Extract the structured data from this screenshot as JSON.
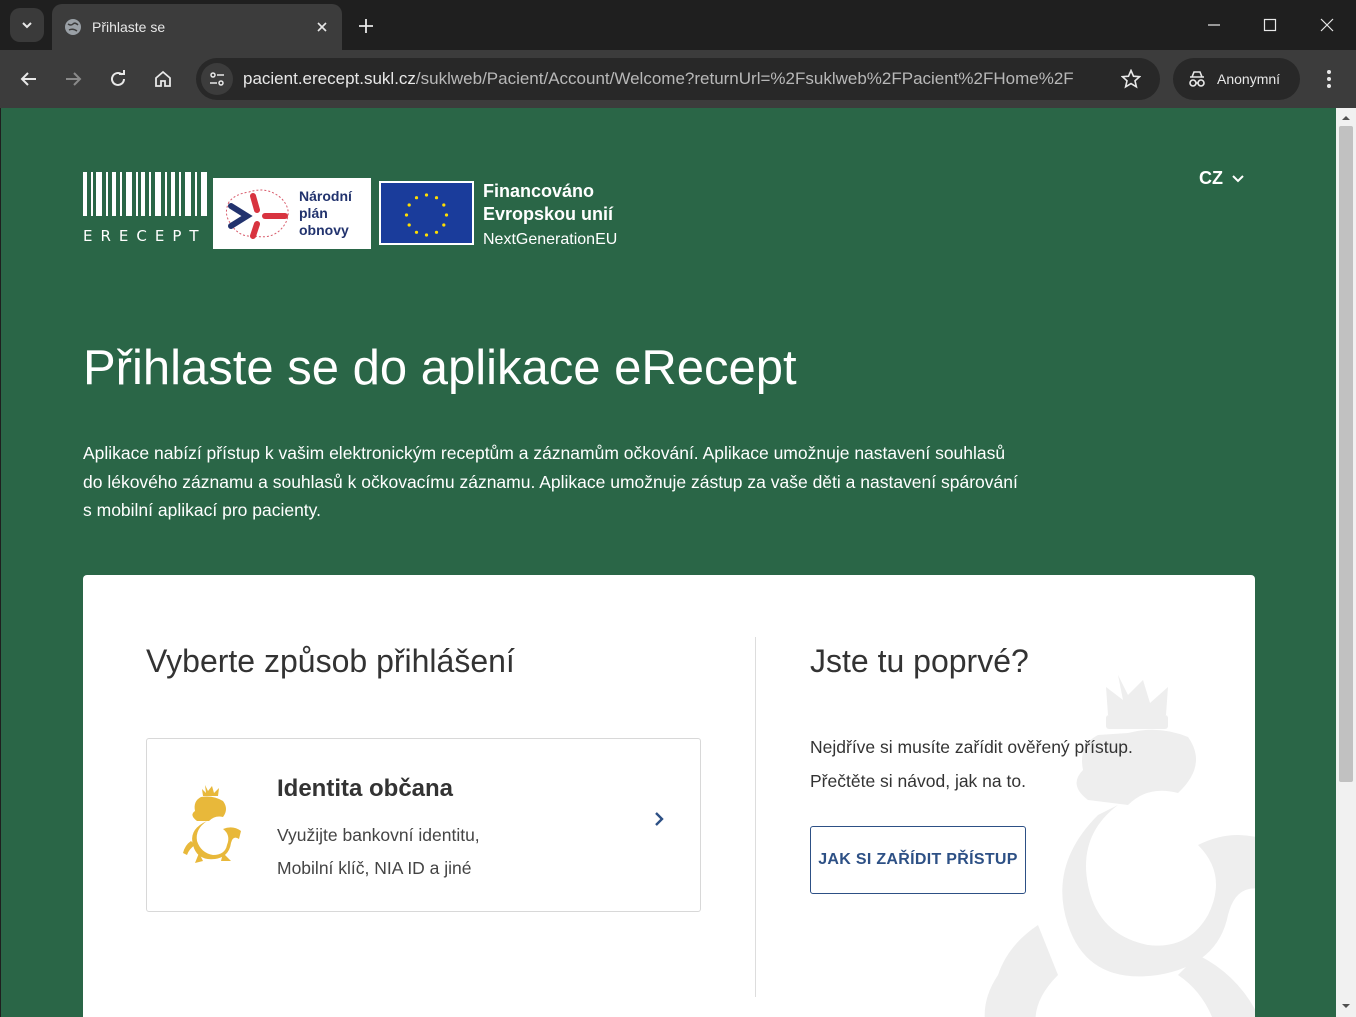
{
  "browser": {
    "tab_title": "Přihlaste se",
    "url_host": "pacient.erecept.sukl.cz",
    "url_path": "/suklweb/Pacient/Account/Welcome?returnUrl=%2Fsuklweb%2FPacient%2FHome%2F",
    "profile_label": "Anonymní"
  },
  "header": {
    "erecept_logo_text": "ERECEPT",
    "npo_text": [
      "Národní",
      "plán",
      "obnovy"
    ],
    "eu_line1": "Financováno",
    "eu_line2": "Evropskou unií",
    "eu_line3": "NextGenerationEU",
    "language": "CZ"
  },
  "main": {
    "title": "Přihlaste se do aplikace eRecept",
    "intro": "Aplikace nabízí přístup k vašim elektronickým receptům a záznamům očkování. Aplikace umožnuje nastavení souhlasů do lékového záznamu a souhlasů k očkovacímu záznamu. Aplikace umožnuje zástup za vaše děti a nastavení spárování s mobilní aplikací pro pacienty."
  },
  "login": {
    "heading": "Vyberte způsob přihlášení",
    "option": {
      "title": "Identita občana",
      "desc_line1": "Využijte bankovní identitu,",
      "desc_line2": "Mobilní klíč, NIA ID a jiné"
    }
  },
  "first_time": {
    "heading": "Jste tu poprvé?",
    "line1": "Nejdříve si musíte zařídit ověřený přístup.",
    "line2": "Přečtěte si návod, jak na to.",
    "button": "JAK SI ZAŘÍDIT PŘÍSTUP"
  },
  "colors": {
    "brand_green": "#2a6647",
    "link_blue": "#2d5085",
    "eu_blue": "#1a3c9b",
    "lion_gold": "#e8b83a"
  }
}
